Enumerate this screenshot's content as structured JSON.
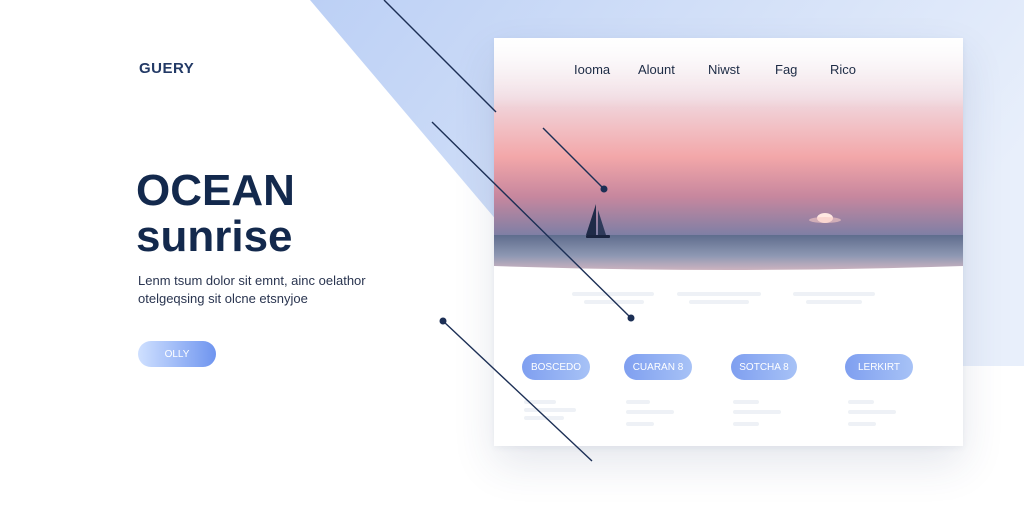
{
  "brand": {
    "name": "GUERY"
  },
  "hero": {
    "title_line1": "OCEAN",
    "title_line2": "sunrise",
    "body": "Lenm tsum dolor sit emnt, ainc oelathor otelgeqsing sit olcne etsnyjoe",
    "cta_label": "OLLY"
  },
  "card": {
    "nav": [
      "Iooma",
      "Alount",
      "Niwst",
      "Fag",
      "Rico"
    ],
    "buttons": [
      "BOSCEDO",
      "CUARAN 8",
      "SOTCHA 8",
      "LERKIRT"
    ]
  },
  "colors": {
    "brand_navy": "#13294d",
    "accent_blue": "#6f95ef",
    "shape_blue": "#b9cff5",
    "sunset_pink": "#f2a0a8",
    "sea": "#6f7d9b"
  },
  "icons": [
    "sailboat-icon",
    "sun-icon"
  ]
}
